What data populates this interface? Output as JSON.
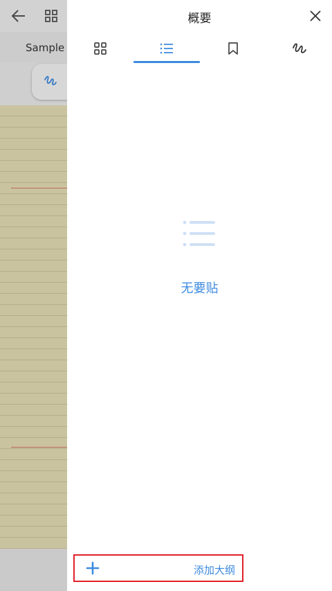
{
  "background": {
    "tab_label": "Sample J",
    "icons": [
      "back-arrow-icon",
      "grid-icon",
      "pen-icon"
    ]
  },
  "panel": {
    "title": "概要",
    "tabs": [
      {
        "id": "thumbnails",
        "icon": "grid-icon",
        "selected": false
      },
      {
        "id": "outline",
        "icon": "list-icon",
        "selected": true
      },
      {
        "id": "bookmarks",
        "icon": "bookmark-icon",
        "selected": false
      },
      {
        "id": "annotations",
        "icon": "pen-squiggle-icon",
        "selected": false
      }
    ],
    "empty_state": {
      "icon": "list-icon",
      "message": "无要贴"
    },
    "add_button": {
      "icon": "plus-icon",
      "label": "添加大纲"
    }
  },
  "colors": {
    "accent": "#3d8be0",
    "highlight_border": "#e0202a",
    "paper": "#e6dfb6"
  }
}
